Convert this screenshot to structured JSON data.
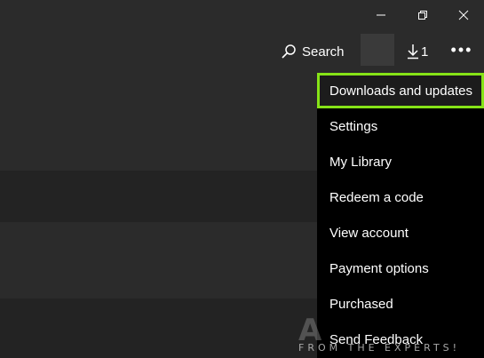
{
  "titlebar": {
    "icons": {
      "minimize": "minimize-icon",
      "restore": "restore-icon",
      "close": "close-icon"
    }
  },
  "header": {
    "search_label": "Search",
    "downloads_count": "1",
    "more_label": "•••"
  },
  "menu": {
    "items": [
      {
        "label": "Downloads and updates",
        "highlighted": true
      },
      {
        "label": "Settings"
      },
      {
        "label": "My Library"
      },
      {
        "label": "Redeem a code"
      },
      {
        "label": "View account"
      },
      {
        "label": "Payment options"
      },
      {
        "label": "Purchased"
      },
      {
        "label": "Send Feedback"
      }
    ],
    "highlight_color": "#86e317"
  },
  "watermark": {
    "brand": "A",
    "tagline": "FROM THE EXPERTS!"
  },
  "colors": {
    "background": "#2b2b2b",
    "menu_background": "#000000",
    "text": "#ffffff"
  }
}
